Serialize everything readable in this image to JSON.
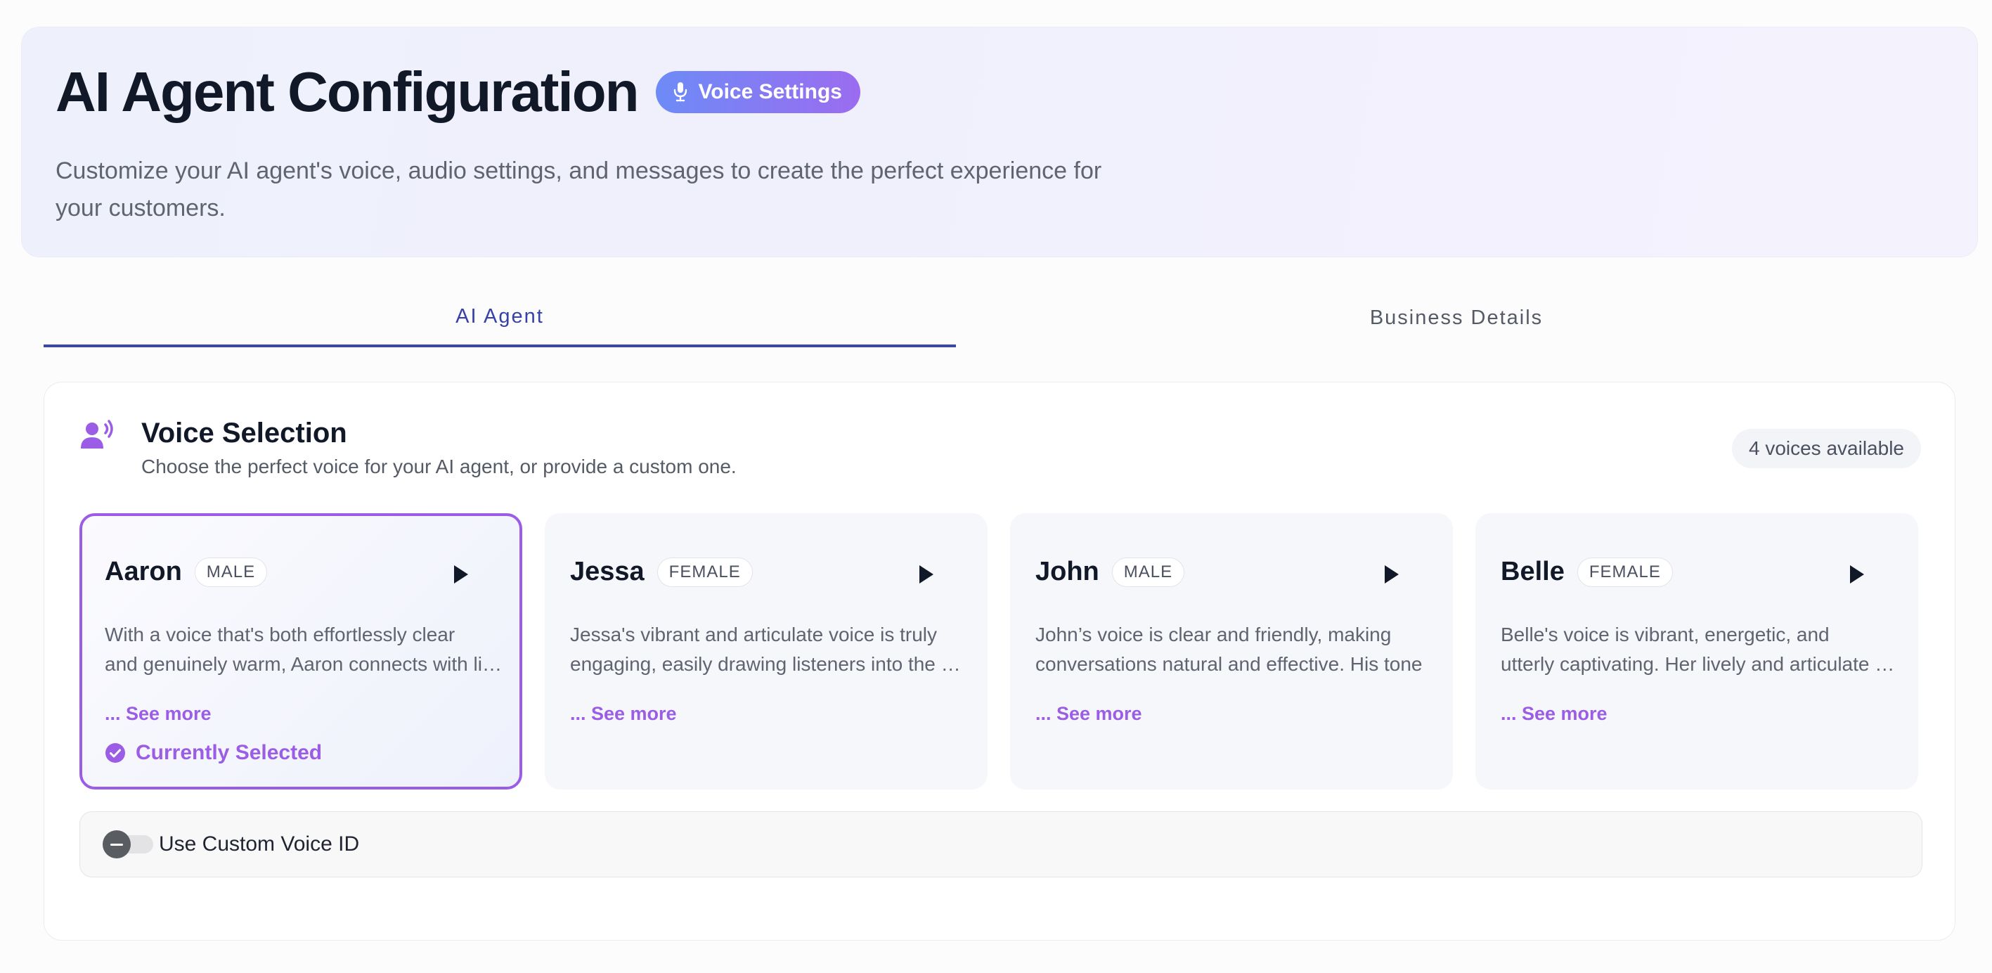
{
  "header": {
    "title": "AI Agent Configuration",
    "badge_label": "Voice Settings",
    "badge_icon": "microphone-icon",
    "subtitle_lines": [
      "Customize your AI agent's voice, audio settings, and messages to create the perfect experience for",
      "your customers."
    ]
  },
  "tabs": [
    {
      "label": "AI Agent",
      "active": true
    },
    {
      "label": "Business Details",
      "active": false
    }
  ],
  "voice_section": {
    "icon": "speaking-person-icon",
    "title": "Voice Selection",
    "subtitle": "Choose the perfect voice for your AI agent, or provide a custom one.",
    "count_label": "4 voices available",
    "voices": [
      {
        "name": "Aaron",
        "gender": "MALE",
        "desc_lines": [
          "With a voice that's both effortlessly clear",
          "and genuinely warm, Aaron connects with listeners"
        ],
        "see_more": "... See more",
        "selected": true,
        "selected_label": "Currently Selected"
      },
      {
        "name": "Jessa",
        "gender": "FEMALE",
        "desc_lines": [
          "Jessa's vibrant and articulate voice is truly",
          "engaging, easily drawing listeners into the story"
        ],
        "see_more": "... See more",
        "selected": false
      },
      {
        "name": "John",
        "gender": "MALE",
        "desc_lines": [
          "John’s voice is clear and friendly, making",
          "conversations natural and effective. His tone"
        ],
        "see_more": "... See more",
        "selected": false
      },
      {
        "name": "Belle",
        "gender": "FEMALE",
        "desc_lines": [
          "Belle's voice is vibrant, energetic, and",
          "utterly captivating. Her lively and articulate style"
        ],
        "see_more": "... See more",
        "selected": false
      }
    ],
    "custom_voice": {
      "label": "Use Custom Voice ID",
      "enabled": false
    }
  },
  "colors": {
    "accent_purple": "#9b5de5",
    "tab_active": "#3742a8",
    "badge_gradient_start": "#6d8bf6",
    "badge_gradient_end": "#9b6cf0"
  }
}
